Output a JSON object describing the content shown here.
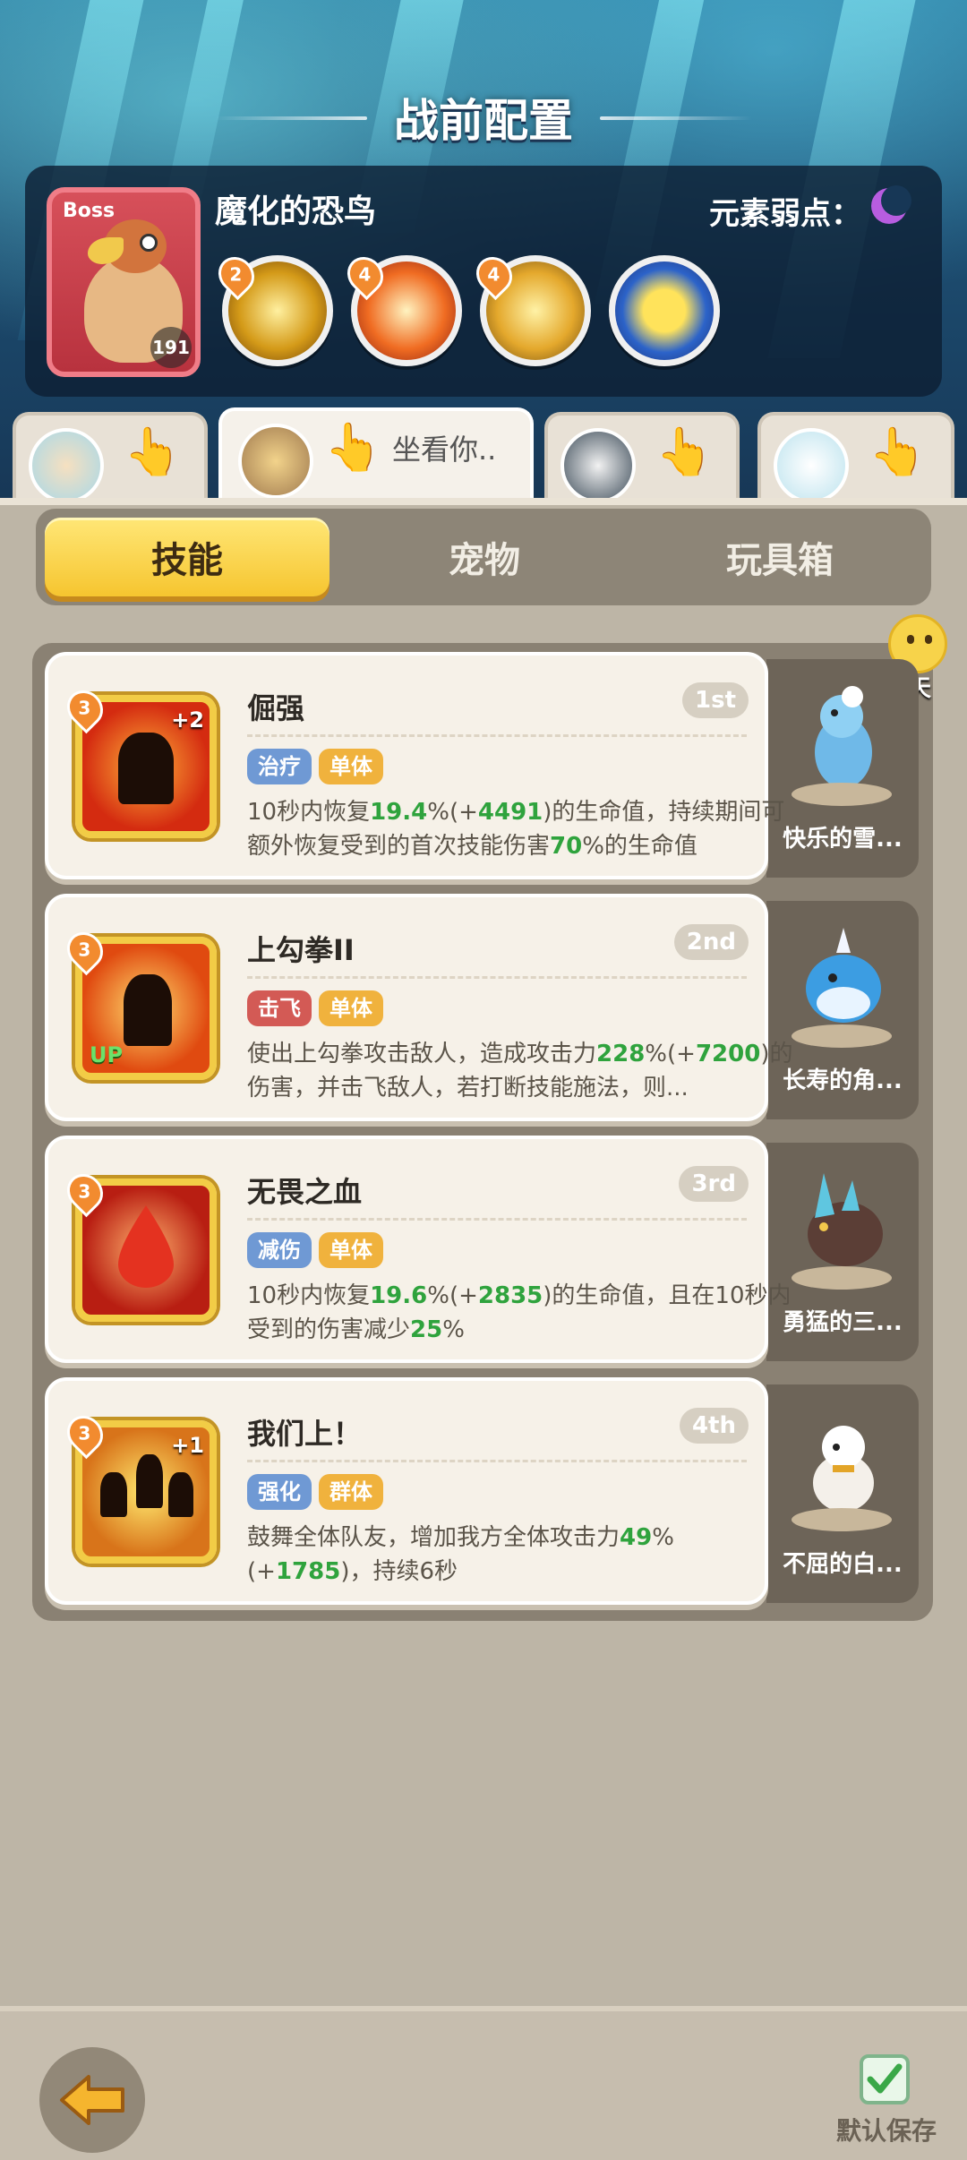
{
  "header": {
    "title": "战前配置"
  },
  "boss": {
    "tag": "Boss",
    "name": "魔化的恐鸟",
    "level": "191",
    "weakness_label": "元素弱点：",
    "weakness_icon": "moon-icon",
    "skills": [
      {
        "level": "2",
        "icon": "golden-claw-icon"
      },
      {
        "level": "4",
        "icon": "fire-slash-icon"
      },
      {
        "level": "4",
        "icon": "golden-star-icon"
      },
      {
        "level": "",
        "icon": "penguin-icon"
      }
    ]
  },
  "teams": [
    {
      "label": "",
      "active": false
    },
    {
      "label": "坐看你..",
      "active": true
    },
    {
      "label": "",
      "active": false
    },
    {
      "label": "",
      "active": false
    }
  ],
  "tabs": [
    {
      "label": "技能",
      "active": true
    },
    {
      "label": "宠物",
      "active": false
    },
    {
      "label": "玩具箱",
      "active": false
    }
  ],
  "chat": {
    "label": "聊天"
  },
  "skills": [
    {
      "name": "倔强",
      "rank": "1st",
      "level": "3",
      "badge": "+2",
      "up": "",
      "tags": [
        {
          "text": "治疗",
          "color": "blue"
        },
        {
          "text": "单体",
          "color": "gold"
        }
      ],
      "desc_parts": [
        "10秒内恢复",
        "19.4",
        "%(+",
        "4491",
        ")的生命值，持续期间可额外恢复受到的首次技能伤害",
        "70",
        "%的生命值"
      ],
      "pet": {
        "name": "快乐的雪..."
      }
    },
    {
      "name": "上勾拳II",
      "rank": "2nd",
      "level": "3",
      "badge": "",
      "up": "UP",
      "tags": [
        {
          "text": "击飞",
          "color": "red"
        },
        {
          "text": "单体",
          "color": "gold"
        }
      ],
      "desc_parts": [
        "使出上勾拳攻击敌人，造成攻击力",
        "228",
        "%(+",
        "7200",
        ")的伤害，并击飞敌人，若打断技能施法，则",
        "",
        "..."
      ],
      "pet": {
        "name": "长寿的角..."
      }
    },
    {
      "name": "无畏之血",
      "rank": "3rd",
      "level": "3",
      "badge": "",
      "up": "",
      "tags": [
        {
          "text": "减伤",
          "color": "blue"
        },
        {
          "text": "单体",
          "color": "gold"
        }
      ],
      "desc_parts": [
        "10秒内恢复",
        "19.6",
        "%(+",
        "2835",
        ")的生命值，且在10秒内受到的伤害减少",
        "25",
        "%"
      ],
      "pet": {
        "name": "勇猛的三..."
      }
    },
    {
      "name": "我们上！",
      "rank": "4th",
      "level": "3",
      "badge": "+1",
      "up": "",
      "tags": [
        {
          "text": "强化",
          "color": "blue"
        },
        {
          "text": "群体",
          "color": "gold"
        }
      ],
      "desc_parts": [
        "鼓舞全体队友，增加我方全体攻击力",
        "49",
        "%(+",
        "1785",
        ")，持续6秒",
        "",
        ""
      ],
      "pet": {
        "name": "不屈的白..."
      }
    }
  ],
  "footer": {
    "save_label": "默认保存",
    "back_icon": "back-arrow-icon",
    "save_icon": "checkmark-icon"
  }
}
